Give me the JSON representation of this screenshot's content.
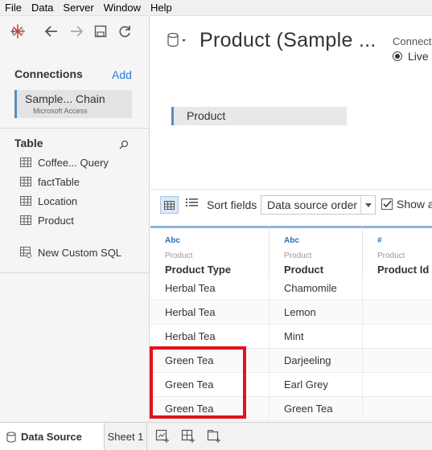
{
  "menu": [
    "File",
    "Data",
    "Server",
    "Window",
    "Help"
  ],
  "connections": {
    "title": "Connections",
    "add_label": "Add",
    "items": [
      {
        "name": "Sample... Chain",
        "type": "Microsoft Access"
      }
    ]
  },
  "tables": {
    "title": "Table",
    "items": [
      "Coffee... Query",
      "factTable",
      "Location",
      "Product"
    ],
    "custom_sql": "New Custom SQL"
  },
  "datasource": {
    "title": "Product (Sample ...",
    "connection_label": "Connect",
    "connection_mode": "Live",
    "canvas_table": "Product"
  },
  "grid_toolbar": {
    "sort_label": "Sort fields",
    "sort_value": "Data source order",
    "show_aliases_label": "Show a"
  },
  "grid": {
    "columns": [
      {
        "type": "Abc",
        "source": "Product",
        "name": "Product Type"
      },
      {
        "type": "Abc",
        "source": "Product",
        "name": "Product"
      },
      {
        "type": "#",
        "source": "Product",
        "name": "Product Id"
      }
    ],
    "rows": [
      [
        "Herbal Tea",
        "Chamomile",
        ""
      ],
      [
        "Herbal Tea",
        "Lemon",
        ""
      ],
      [
        "Herbal Tea",
        "Mint",
        ""
      ],
      [
        "Green Tea",
        "Darjeeling",
        ""
      ],
      [
        "Green Tea",
        "Earl Grey",
        ""
      ],
      [
        "Green Tea",
        "Green Tea",
        ""
      ]
    ]
  },
  "tabs": {
    "data_source": "Data Source",
    "sheet1": "Sheet 1"
  },
  "colors": {
    "accent": "#5b8db8",
    "link": "#2a7bd3",
    "highlight": "#e0141e"
  }
}
